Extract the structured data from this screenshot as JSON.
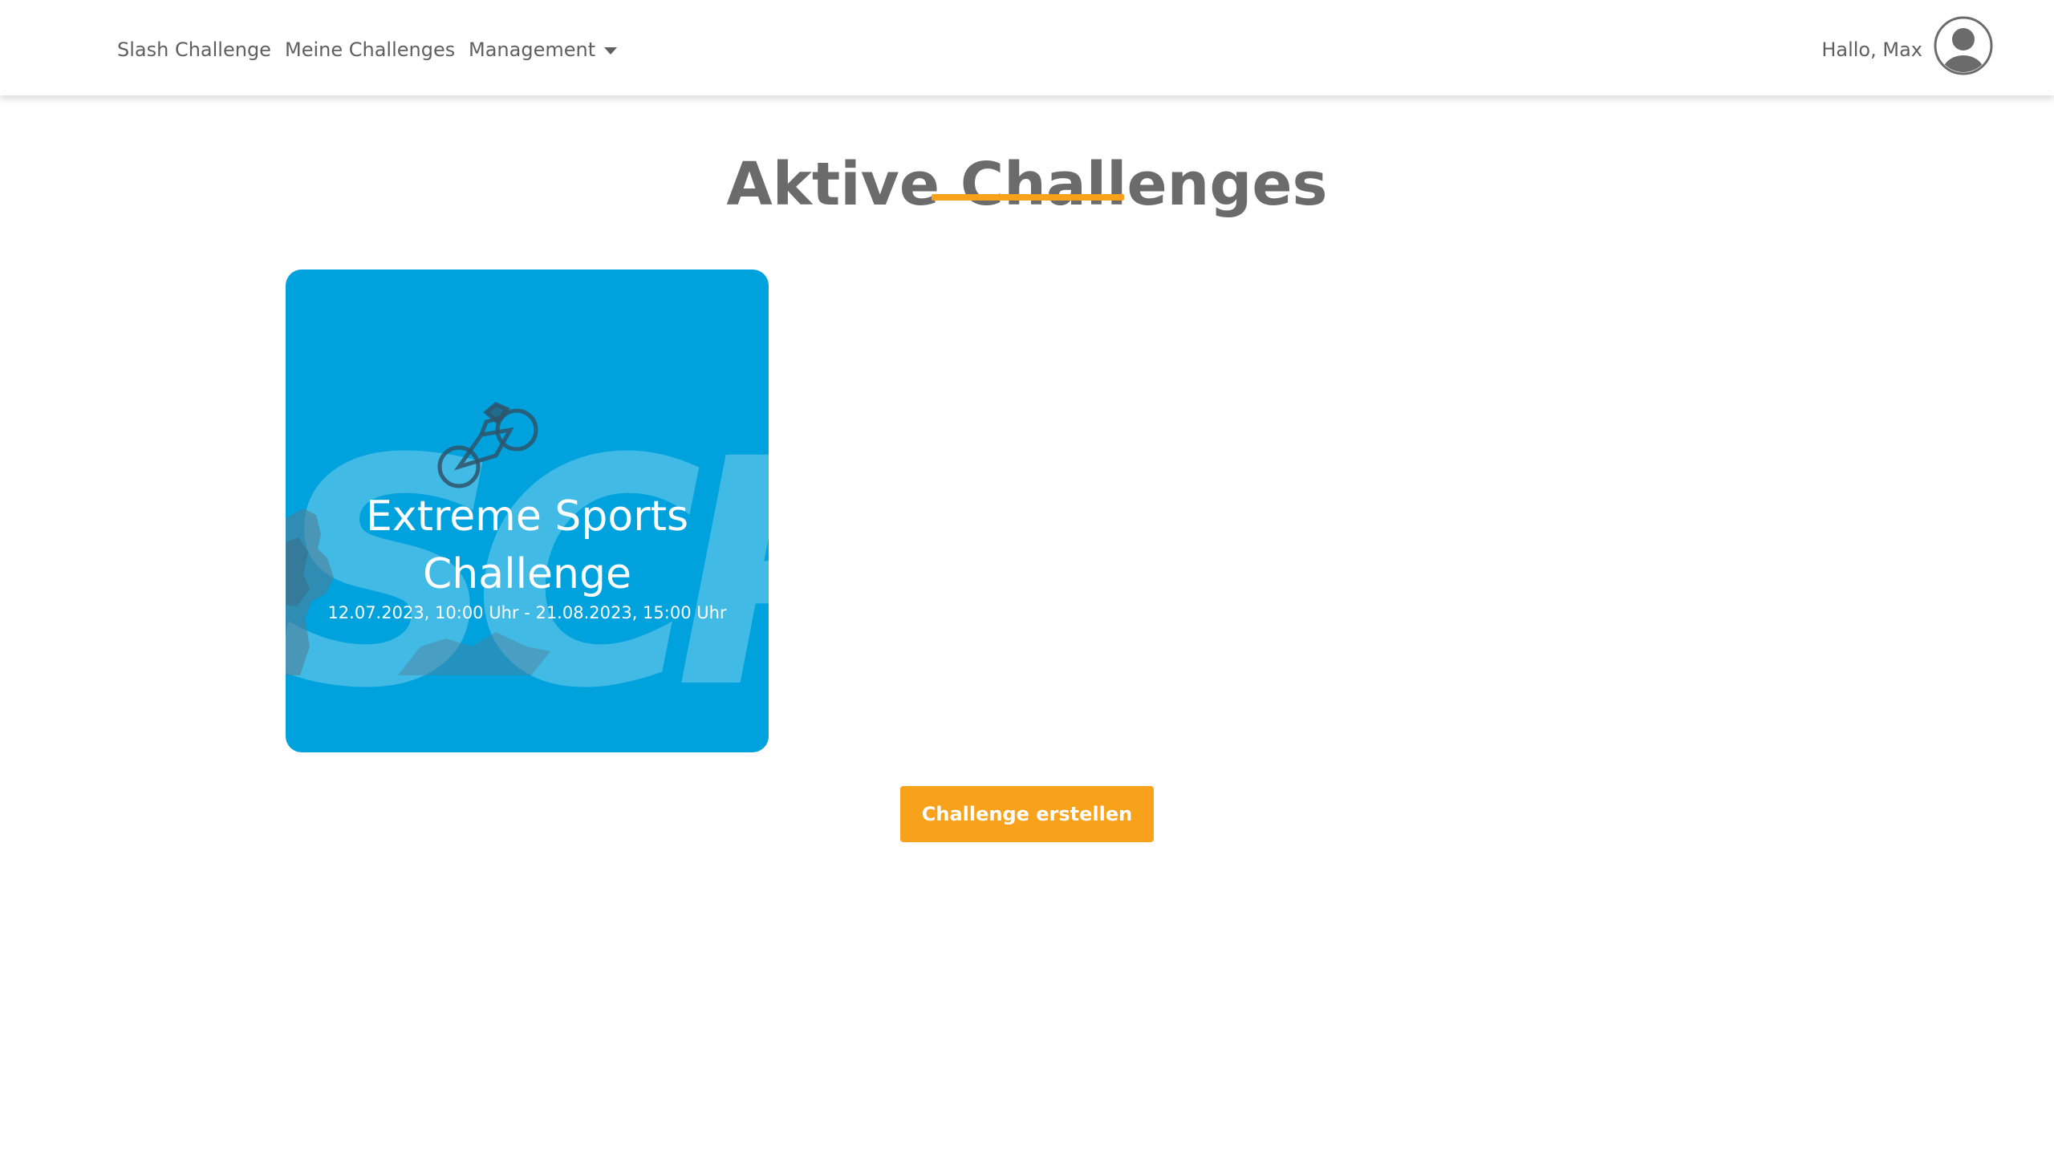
{
  "nav": {
    "items": [
      {
        "label": "Slash Challenge"
      },
      {
        "label": "Meine Challenges"
      },
      {
        "label": "Management"
      }
    ],
    "greeting": "Hallo, Max",
    "avatar_icon": "user-circle-icon"
  },
  "main": {
    "title": "Aktive Challenges",
    "accent_color": "#f7a21a",
    "challenges": [
      {
        "title": "Extreme Sports Challenge",
        "dates": "12.07.2023, 10:00 Uhr - 21.08.2023, 15:00 Uhr",
        "card_color": "#00a2de",
        "background_logo_text": "SCP",
        "background_icon": "mountain-bike-jump-icon"
      }
    ],
    "create_button_label": "Challenge erstellen"
  }
}
